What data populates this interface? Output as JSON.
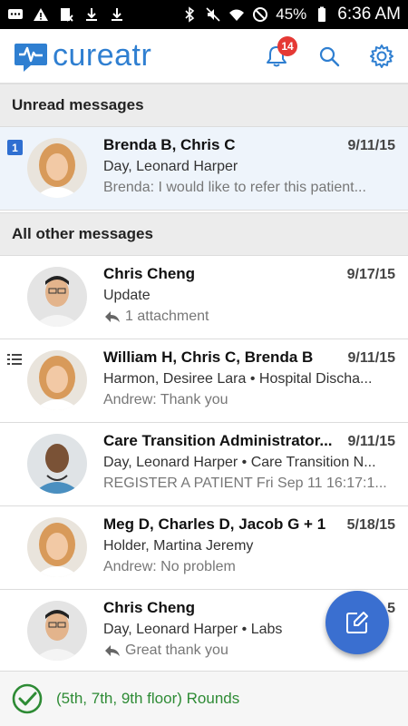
{
  "status_bar": {
    "battery": "45%",
    "time": "6:36 AM"
  },
  "app": {
    "brand": "cureatr",
    "notifications_count": "14"
  },
  "sections": {
    "unread": "Unread messages",
    "other": "All other messages"
  },
  "unread_messages": [
    {
      "unread_count": "1",
      "title": "Brenda B, Chris C",
      "date": "9/11/15",
      "subtitle": "Day, Leonard Harper",
      "preview": "Brenda: I would like to refer this patient..."
    }
  ],
  "messages": [
    {
      "title": "Chris Cheng",
      "date": "9/17/15",
      "subtitle": "Update",
      "preview": "1 attachment"
    },
    {
      "title": "William H, Chris C, Brenda B",
      "date": "9/11/15",
      "subtitle": "Harmon, Desiree Lara • Hospital Discha...",
      "preview": "Andrew: Thank you"
    },
    {
      "title": "Care Transition Administrator...",
      "date": "9/11/15",
      "subtitle": "Day, Leonard Harper • Care Transition N...",
      "preview": "REGISTER A PATIENT Fri Sep 11 16:17:1..."
    },
    {
      "title": "Meg D, Charles D, Jacob G + 1",
      "date": "5/18/15",
      "subtitle": "Holder, Martina Jeremy",
      "preview": "Andrew: No problem"
    },
    {
      "title": "Chris Cheng",
      "date": "5",
      "subtitle": "Day, Leonard Harper • Labs",
      "preview": "Great thank you"
    }
  ],
  "bottom_bar": {
    "label": "(5th, 7th, 9th floor) Rounds"
  },
  "colors": {
    "brand_blue": "#2f7fd1",
    "badge_red": "#e53935",
    "fab_blue": "#3a6fd0",
    "success_green": "#2e8b35"
  }
}
